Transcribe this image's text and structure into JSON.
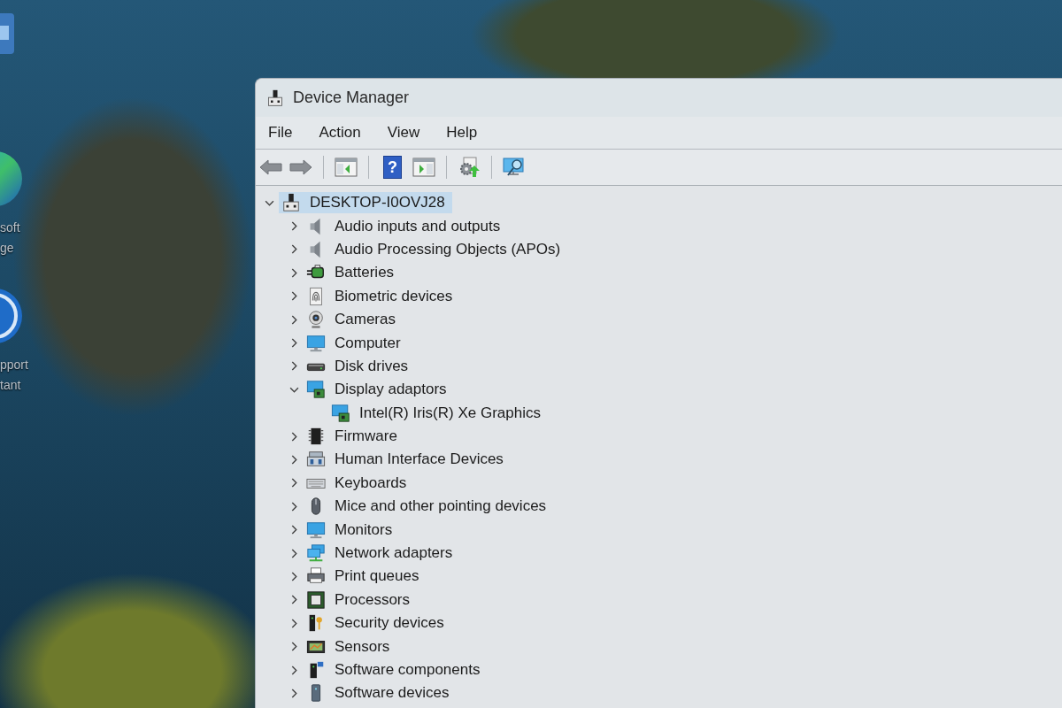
{
  "desktop_icons": [
    {
      "kind": "tile"
    },
    {
      "kind": "browser",
      "label": [
        "soft",
        "ge"
      ]
    },
    {
      "kind": "support",
      "label": [
        "pport",
        "tant"
      ]
    }
  ],
  "window": {
    "title": "Device Manager",
    "menu": [
      "File",
      "Action",
      "View",
      "Help"
    ],
    "toolbar": [
      {
        "kind": "back"
      },
      {
        "kind": "forward"
      },
      {
        "kind": "separator"
      },
      {
        "kind": "console-tree"
      },
      {
        "kind": "separator"
      },
      {
        "kind": "help",
        "glyph": "?"
      },
      {
        "kind": "action-pane"
      },
      {
        "kind": "separator"
      },
      {
        "kind": "update-driver"
      },
      {
        "kind": "separator"
      },
      {
        "kind": "scan"
      }
    ],
    "tree": {
      "label": "DESKTOP-I0OVJ28",
      "kind": "computer",
      "expanded": true,
      "selected": true,
      "children": [
        {
          "label": "Audio inputs and outputs",
          "kind": "speaker",
          "expanded": false,
          "selected": false
        },
        {
          "label": "Audio Processing Objects (APOs)",
          "kind": "speaker",
          "expanded": false,
          "selected": false
        },
        {
          "label": "Batteries",
          "kind": "battery",
          "expanded": false,
          "selected": false
        },
        {
          "label": "Biometric devices",
          "kind": "fingerprint",
          "expanded": false,
          "selected": false
        },
        {
          "label": "Cameras",
          "kind": "webcam",
          "expanded": false,
          "selected": false
        },
        {
          "label": "Computer",
          "kind": "monitor",
          "expanded": false,
          "selected": false
        },
        {
          "label": "Disk drives",
          "kind": "disk",
          "expanded": false,
          "selected": false
        },
        {
          "label": "Display adaptors",
          "kind": "display-adapter",
          "expanded": true,
          "selected": false,
          "children": [
            {
              "label": "Intel(R) Iris(R) Xe Graphics",
              "kind": "display-adapter",
              "selected": false
            }
          ]
        },
        {
          "label": "Firmware",
          "kind": "chip",
          "expanded": false,
          "selected": false
        },
        {
          "label": "Human Interface Devices",
          "kind": "hid",
          "expanded": false,
          "selected": false
        },
        {
          "label": "Keyboards",
          "kind": "keyboard",
          "expanded": false,
          "selected": false
        },
        {
          "label": "Mice and other pointing devices",
          "kind": "mouse",
          "expanded": false,
          "selected": false
        },
        {
          "label": "Monitors",
          "kind": "monitor",
          "expanded": false,
          "selected": false
        },
        {
          "label": "Network adapters",
          "kind": "network",
          "expanded": false,
          "selected": false
        },
        {
          "label": "Print queues",
          "kind": "printer",
          "expanded": false,
          "selected": false
        },
        {
          "label": "Processors",
          "kind": "processor",
          "expanded": false,
          "selected": false
        },
        {
          "label": "Security devices",
          "kind": "security",
          "expanded": false,
          "selected": false
        },
        {
          "label": "Sensors",
          "kind": "sensor",
          "expanded": false,
          "selected": false
        },
        {
          "label": "Software components",
          "kind": "software-component",
          "expanded": false,
          "selected": false
        },
        {
          "label": "Software devices",
          "kind": "software-device",
          "expanded": false,
          "selected": false
        }
      ]
    }
  }
}
